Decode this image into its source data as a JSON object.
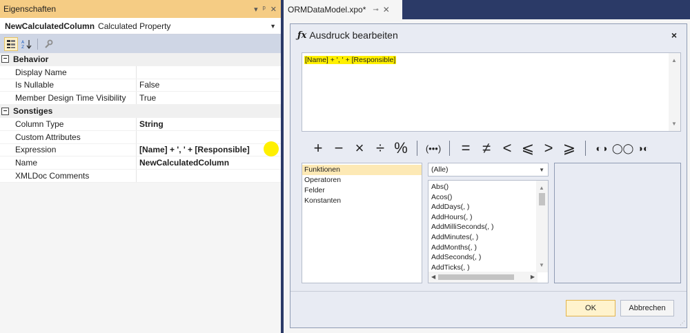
{
  "properties_panel": {
    "title": "Eigenschaften",
    "title_buttons": {
      "dropdown": "▾",
      "pin": "ᵖ",
      "close": "✕"
    },
    "object": {
      "name": "NewCalculatedColumn",
      "type": "Calculated Property"
    },
    "toolbar": {
      "categorized_icon": "categorized-icon",
      "alphabetical_icon": "alphabetical-icon",
      "property_pages_icon": "wrench-icon"
    },
    "rows": [
      {
        "kind": "category",
        "toggle": "⊟",
        "label": "Behavior"
      },
      {
        "kind": "item",
        "name": "Display Name",
        "value": "",
        "bold": false
      },
      {
        "kind": "item",
        "name": "Is Nullable",
        "value": "False",
        "bold": false
      },
      {
        "kind": "item",
        "name": "Member Design Time Visibility",
        "value": "True",
        "bold": false
      },
      {
        "kind": "category",
        "toggle": "⊟",
        "label": "Sonstiges"
      },
      {
        "kind": "item",
        "name": "Column Type",
        "value": "String",
        "bold": true
      },
      {
        "kind": "item",
        "name": "Custom Attributes",
        "value": "",
        "bold": false
      },
      {
        "kind": "item",
        "name": "Expression",
        "value": "[Name] + ', ' + [Responsible]",
        "bold": true
      },
      {
        "kind": "item",
        "name": "Name",
        "value": "NewCalculatedColumn",
        "bold": true
      },
      {
        "kind": "item",
        "name": "XMLDoc Comments",
        "value": "",
        "bold": false
      }
    ],
    "highlight_color": "#fff000"
  },
  "document_tab": {
    "label": "ORMDataModel.xpo*",
    "pin": "⊸",
    "close": "✕"
  },
  "dialog": {
    "title": "Ausdruck bearbeiten",
    "title_icon": "fx-icon",
    "close": "×",
    "expression": "[Name] + ', ' + [Responsible]",
    "operators": [
      {
        "glyph": "+",
        "name": "plus-operator"
      },
      {
        "glyph": "−",
        "name": "minus-operator"
      },
      {
        "glyph": "×",
        "name": "multiply-operator"
      },
      {
        "glyph": "÷",
        "name": "divide-operator"
      },
      {
        "glyph": "%",
        "name": "modulo-operator"
      },
      {
        "sep": true
      },
      {
        "glyph": "(•••)",
        "name": "parentheses-operator",
        "cls": "par"
      },
      {
        "sep": true
      },
      {
        "glyph": "=",
        "name": "equals-operator"
      },
      {
        "glyph": "≠",
        "name": "not-equals-operator"
      },
      {
        "glyph": "<",
        "name": "less-than-operator"
      },
      {
        "glyph": "⩽",
        "name": "less-equal-operator"
      },
      {
        "glyph": ">",
        "name": "greater-than-operator"
      },
      {
        "glyph": "⩾",
        "name": "greater-equal-operator"
      },
      {
        "sep": true
      },
      {
        "glyph": "◐◑",
        "name": "and-operator",
        "cls": "small"
      },
      {
        "glyph": "◯◯",
        "name": "or-operator",
        "cls": "small"
      },
      {
        "glyph": "◑◐",
        "name": "not-operator",
        "cls": "small"
      }
    ],
    "categories": [
      "Funktionen",
      "Operatoren",
      "Felder",
      "Konstanten"
    ],
    "selected_category": "Funktionen",
    "filter": "(Alle)",
    "functions": [
      "Abs()",
      "Acos()",
      "AddDays(, )",
      "AddHours(, )",
      "AddMilliSeconds(, )",
      "AddMinutes(, )",
      "AddMonths(, )",
      "AddSeconds(, )",
      "AddTicks(, )"
    ],
    "ok_label": "OK",
    "cancel_label": "Abbrechen"
  }
}
